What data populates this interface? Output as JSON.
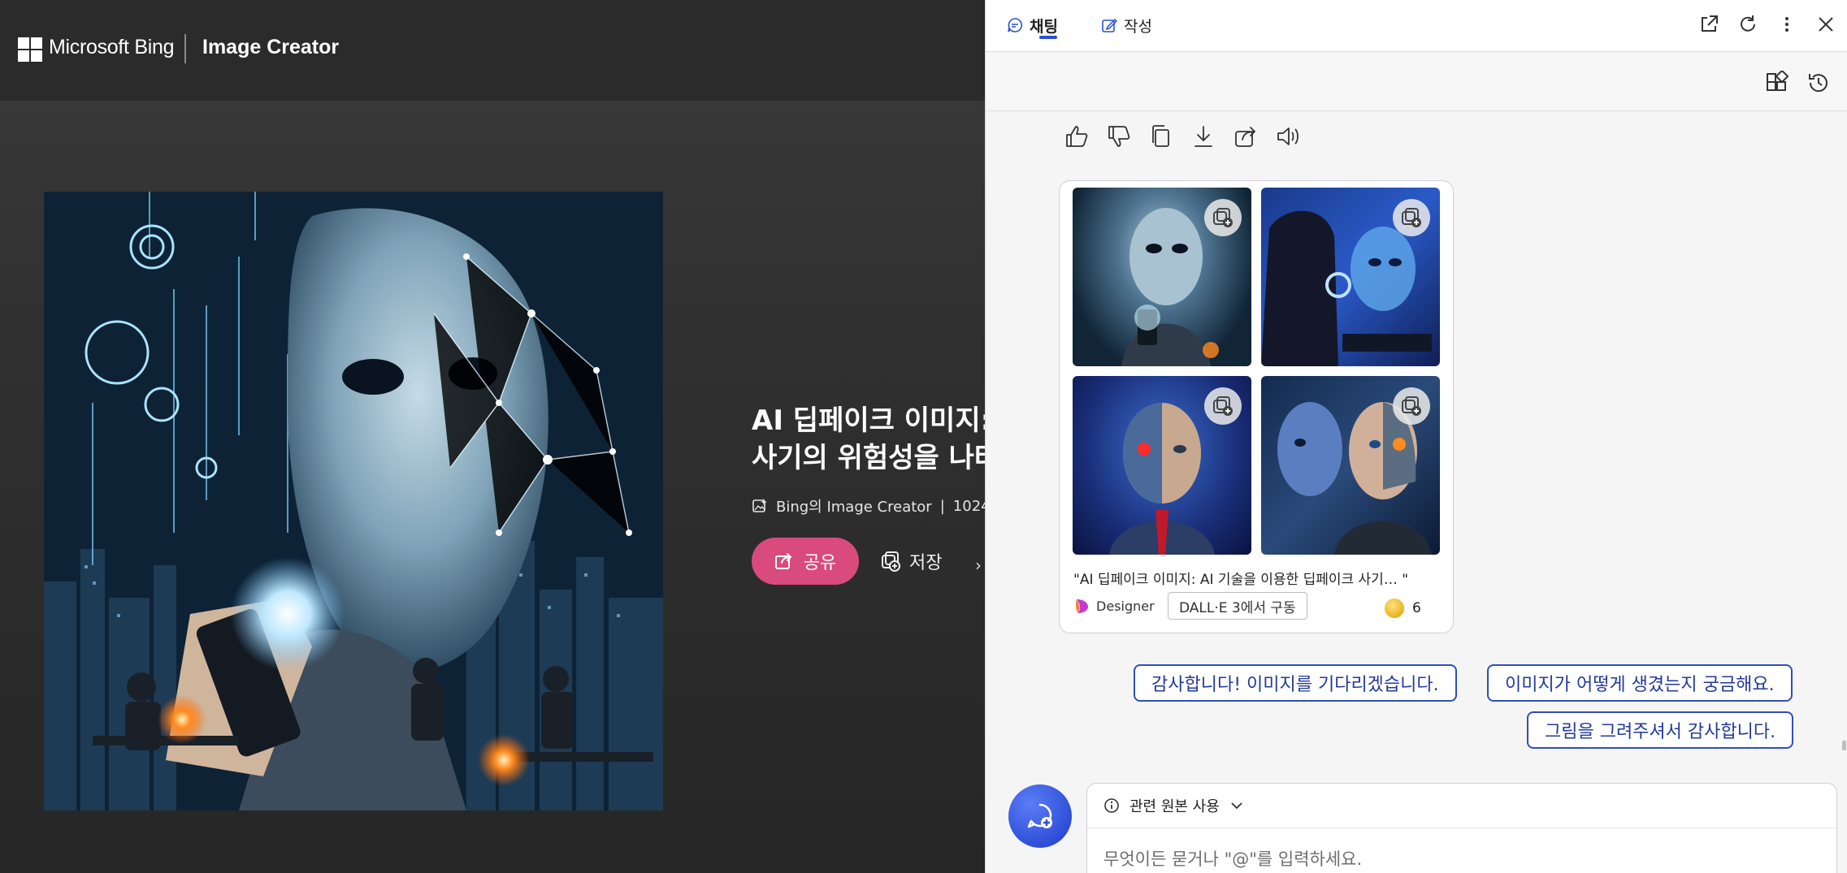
{
  "header": {
    "brand": "Microsoft Bing",
    "product": "Image Creator"
  },
  "viewer": {
    "title_line1": "AI 딥페이크 이미지:",
    "title_line2": "사기의 위험성을 나타",
    "source": "Bing의 Image Creator",
    "separator": "|",
    "size": "1024 ×",
    "share_label": "공유",
    "save_label": "저장"
  },
  "copilot": {
    "tabs": [
      {
        "label": "채팅",
        "icon": "chat-icon",
        "active": true
      },
      {
        "label": "작성",
        "icon": "compose-icon",
        "active": false
      }
    ],
    "header_icons": [
      "open-external-icon",
      "refresh-icon",
      "more-icon",
      "close-icon"
    ],
    "toolbar_icons": [
      "plugins-icon",
      "history-icon"
    ],
    "reactions": [
      "thumbs-up-icon",
      "thumbs-down-icon",
      "copy-icon",
      "download-icon",
      "share-icon",
      "speaker-icon"
    ],
    "result_card": {
      "caption": "\"AI 딥페이크 이미지: AI 기술을 이용한 딥페이크 사기… \"",
      "designer_label": "Designer",
      "model_badge": "DALL·E 3에서 구동",
      "boost_count": "6"
    },
    "suggestions": [
      "감사합니다! 이미지를 기다리겠습니다.",
      "이미지가 어떻게 생겼는지 궁금해요.",
      "그림을 그려주셔서 감사합니다."
    ],
    "composer": {
      "source_toggle": "관련 원본 사용",
      "placeholder": "무엇이든 묻거나 \"@\"를 입력하세요."
    }
  },
  "colors": {
    "share_button": "#d94a7d",
    "accent_blue": "#2a4fd6",
    "chip_text": "#223a9a"
  }
}
